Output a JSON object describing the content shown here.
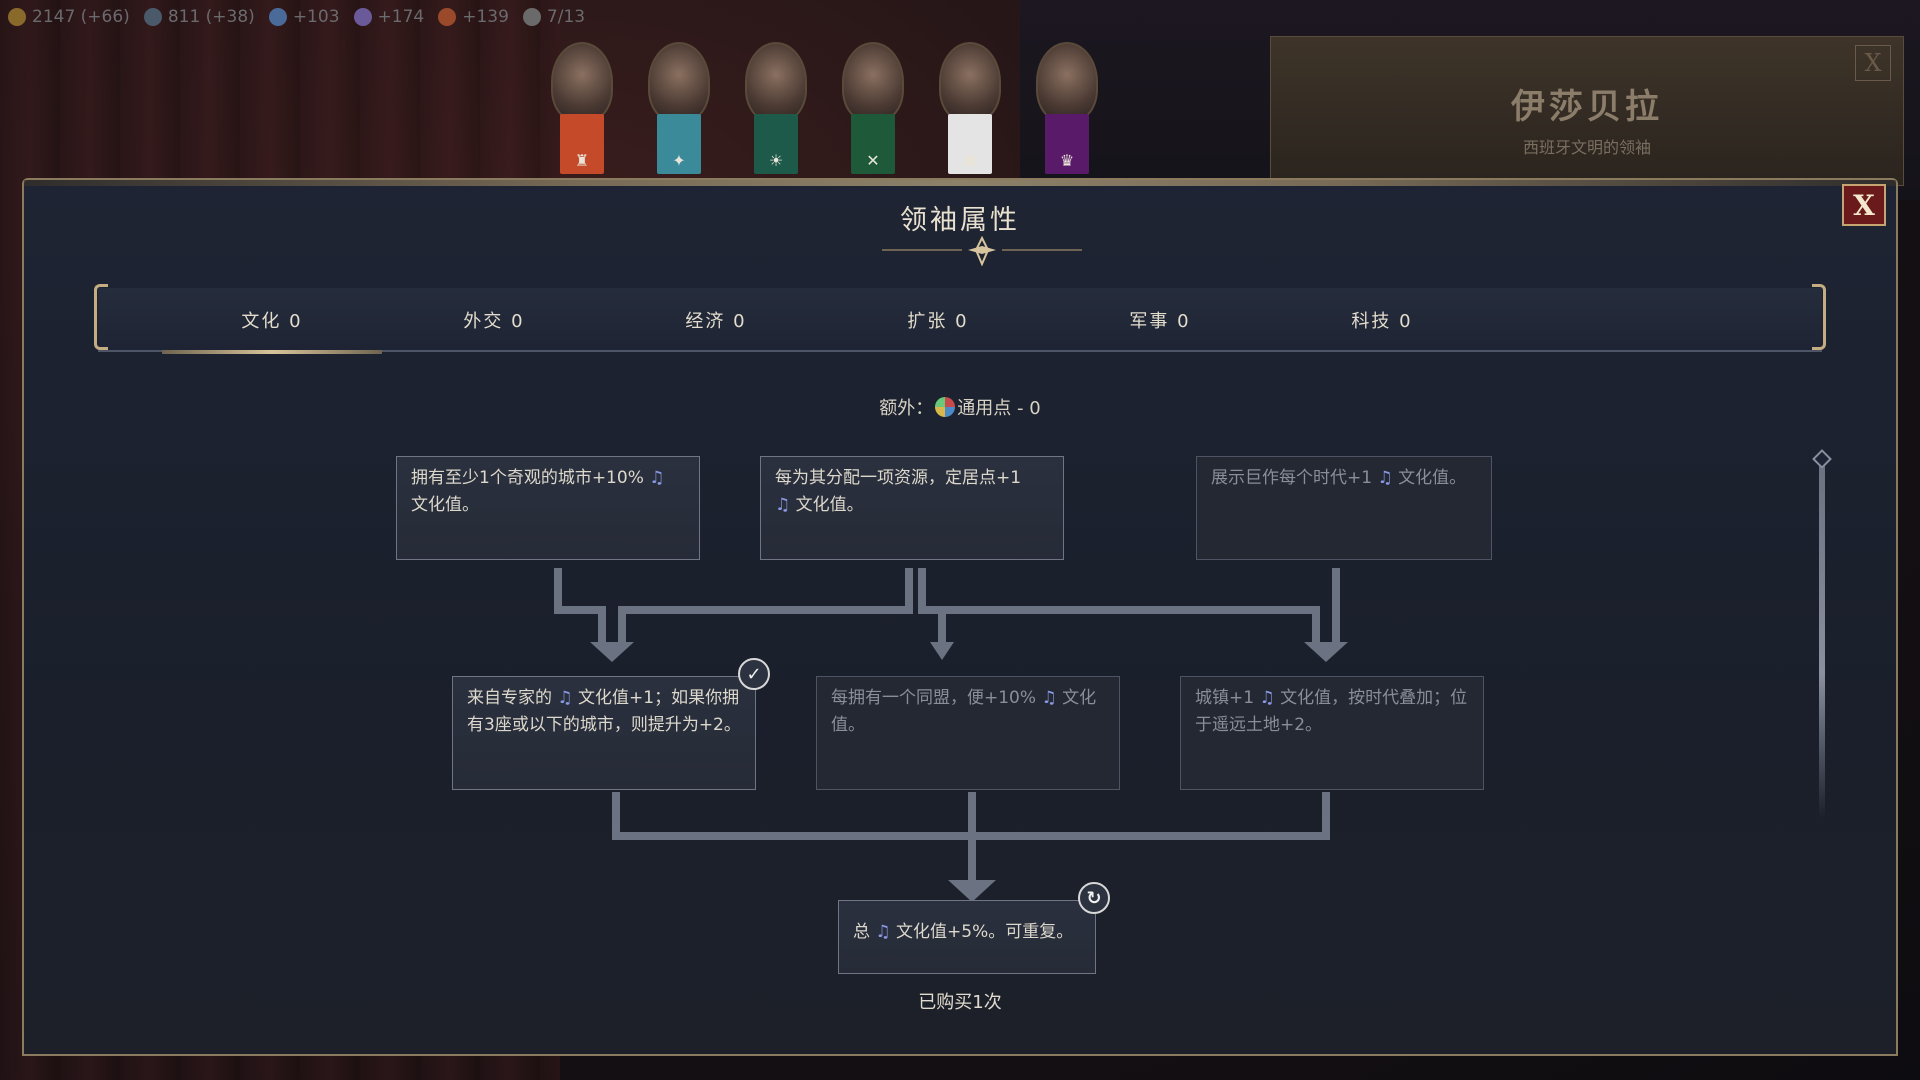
{
  "resources": [
    {
      "icon": "gold-icon",
      "text": "2147 (+66)",
      "color": "#8a6a2a"
    },
    {
      "icon": "globe-icon",
      "text": "811 (+38)",
      "color": "#4a5a6a"
    },
    {
      "icon": "science-icon",
      "text": "+103",
      "color": "#4a6a9a"
    },
    {
      "icon": "culture-icon",
      "text": "+174",
      "color": "#6a5a9a"
    },
    {
      "icon": "faith-icon",
      "text": "+139",
      "color": "#9a4a2a"
    },
    {
      "icon": "city-icon",
      "text": "7/13",
      "color": "#6a6a6a"
    }
  ],
  "leaders": [
    {
      "name": "leader-portrait-1",
      "banner_color": "#c44a2a",
      "glyph": "♜"
    },
    {
      "name": "leader-portrait-2",
      "banner_color": "#3a8a9a",
      "glyph": "✦"
    },
    {
      "name": "leader-portrait-3",
      "banner_color": "#1e5a4a",
      "glyph": "☀"
    },
    {
      "name": "leader-portrait-4",
      "banner_color": "#1e5a3a",
      "glyph": "✕"
    },
    {
      "name": "leader-portrait-5",
      "banner_color": "#e4e4e4",
      "glyph": "☗"
    },
    {
      "name": "leader-portrait-6",
      "banner_color": "#5a1a6a",
      "glyph": "♛"
    }
  ],
  "leader_card": {
    "name": "伊莎贝拉",
    "subtitle": "西班牙文明的领袖",
    "close_label": "X"
  },
  "panel": {
    "title": "领袖属性",
    "close_label": "X"
  },
  "tabs": [
    {
      "label": "文化 0",
      "active": true
    },
    {
      "label": "外交 0",
      "active": false
    },
    {
      "label": "经济 0",
      "active": false
    },
    {
      "label": "扩张 0",
      "active": false
    },
    {
      "label": "军事 0",
      "active": false
    },
    {
      "label": "科技 0",
      "active": false
    }
  ],
  "extra": {
    "prefix": "额外：",
    "text": "通用点 - 0"
  },
  "nodes": {
    "row1_a": {
      "text_a": "拥有至少1个奇观的城市+10% ",
      "text_b": "文化值。"
    },
    "row1_b": {
      "text_a": "每为其分配一项资源，定居点+1",
      "text_b": " 文化值。"
    },
    "row1_c": {
      "text_a": "展示巨作每个时代+1 ",
      "text_b": " 文化值。"
    },
    "row2_a": {
      "text_a": "来自专家的 ",
      "text_b": " 文化值+1；如果你拥有3座或以下的城市，则提升为+2。"
    },
    "row2_b": {
      "text_a": "每拥有一个同盟，便+10% ",
      "text_b": " 文化值。"
    },
    "row2_c": {
      "text_a": "城镇+1 ",
      "text_b": " 文化值，按时代叠加；位于遥远土地+2。"
    },
    "final": {
      "text_a": "总 ",
      "text_b": " 文化值+5%。可重复。"
    }
  },
  "purchased": "已购买1次",
  "colors": {
    "accent_gold": "#c4ad82",
    "culture_note": "#8a9ae6",
    "close_red": "#6a1a1a"
  }
}
